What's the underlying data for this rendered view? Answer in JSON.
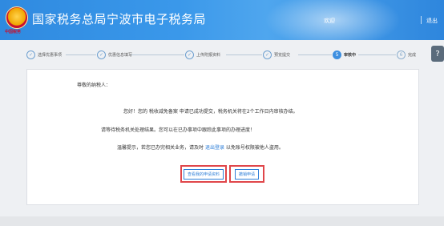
{
  "header": {
    "title": "国家税务总局宁波市电子税务局",
    "welcome": "欢迎",
    "logout": "退出",
    "emblem_text": "中国税务"
  },
  "steps": [
    {
      "label": "选择优惠事项",
      "mark": "✓",
      "state": "done"
    },
    {
      "label": "优惠信息填写",
      "mark": "✓",
      "state": "done"
    },
    {
      "label": "上传附报资料",
      "mark": "✓",
      "state": "done"
    },
    {
      "label": "预览提交",
      "mark": "✓",
      "state": "done"
    },
    {
      "label": "审核中",
      "mark": "5",
      "state": "active"
    },
    {
      "label": "完成",
      "mark": "6",
      "state": "pending"
    }
  ],
  "side_button": "?",
  "card": {
    "greeting": "尊敬的纳税人：",
    "line1": "您好！您的 税收减免备案 申请已成功提交，税务机关将在2个工作日内审核办结。",
    "line2": "请等待税务机关处理结果。您可以在已办事项中跟踪此事项的办理进度！",
    "line3_prefix": "温馨提示，若您已办完相关业务，请及时",
    "line3_link": "退出登录",
    "line3_suffix": "以免账号权限被他人盗用。",
    "button_view": "查看我的申请资料",
    "button_withdraw": "撤销申请"
  }
}
